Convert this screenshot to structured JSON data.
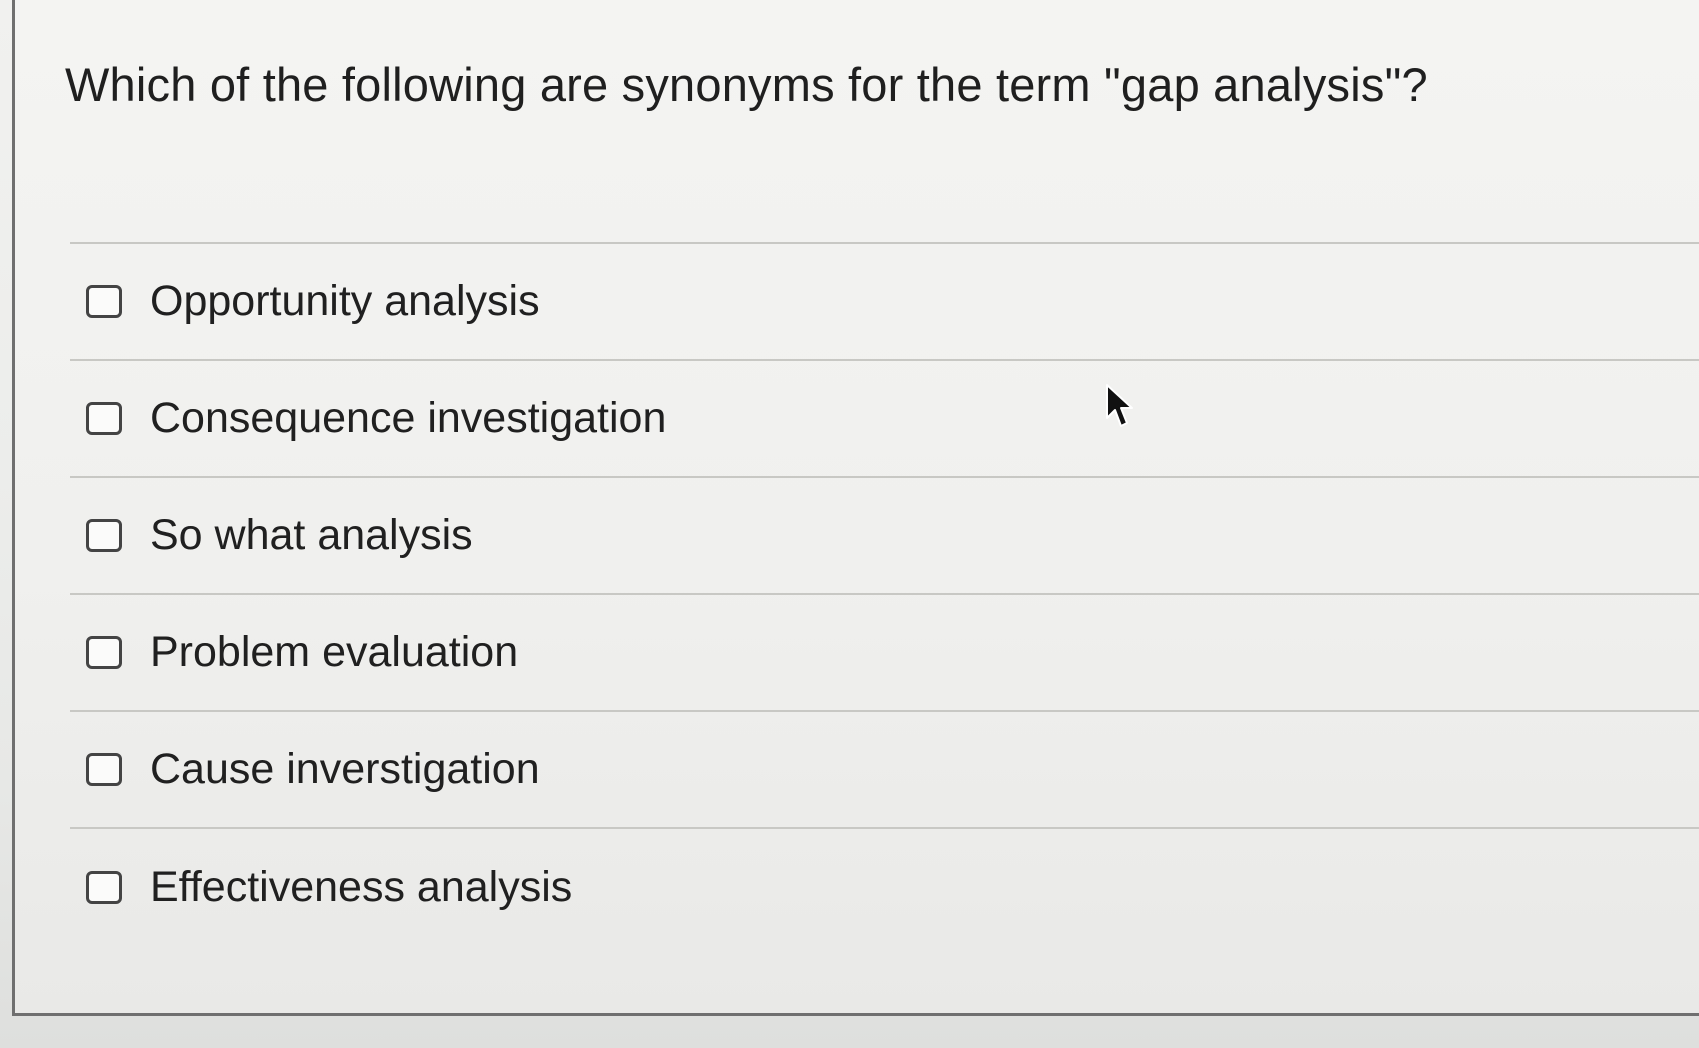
{
  "question": {
    "text": "Which of the following are synonyms for the term \"gap analysis\"?"
  },
  "options": [
    {
      "label": "Opportunity analysis",
      "checked": false
    },
    {
      "label": "Consequence investigation",
      "checked": false
    },
    {
      "label": "So what analysis",
      "checked": false
    },
    {
      "label": "Problem evaluation",
      "checked": false
    },
    {
      "label": "Cause inverstigation",
      "checked": false
    },
    {
      "label": "Effectiveness analysis",
      "checked": false
    }
  ],
  "cursor": {
    "icon": "mouse-pointer-icon"
  },
  "colors": {
    "text": "#202020",
    "border": "#444444",
    "divider": "#c8c8c4",
    "background": "#f0f0ee"
  }
}
